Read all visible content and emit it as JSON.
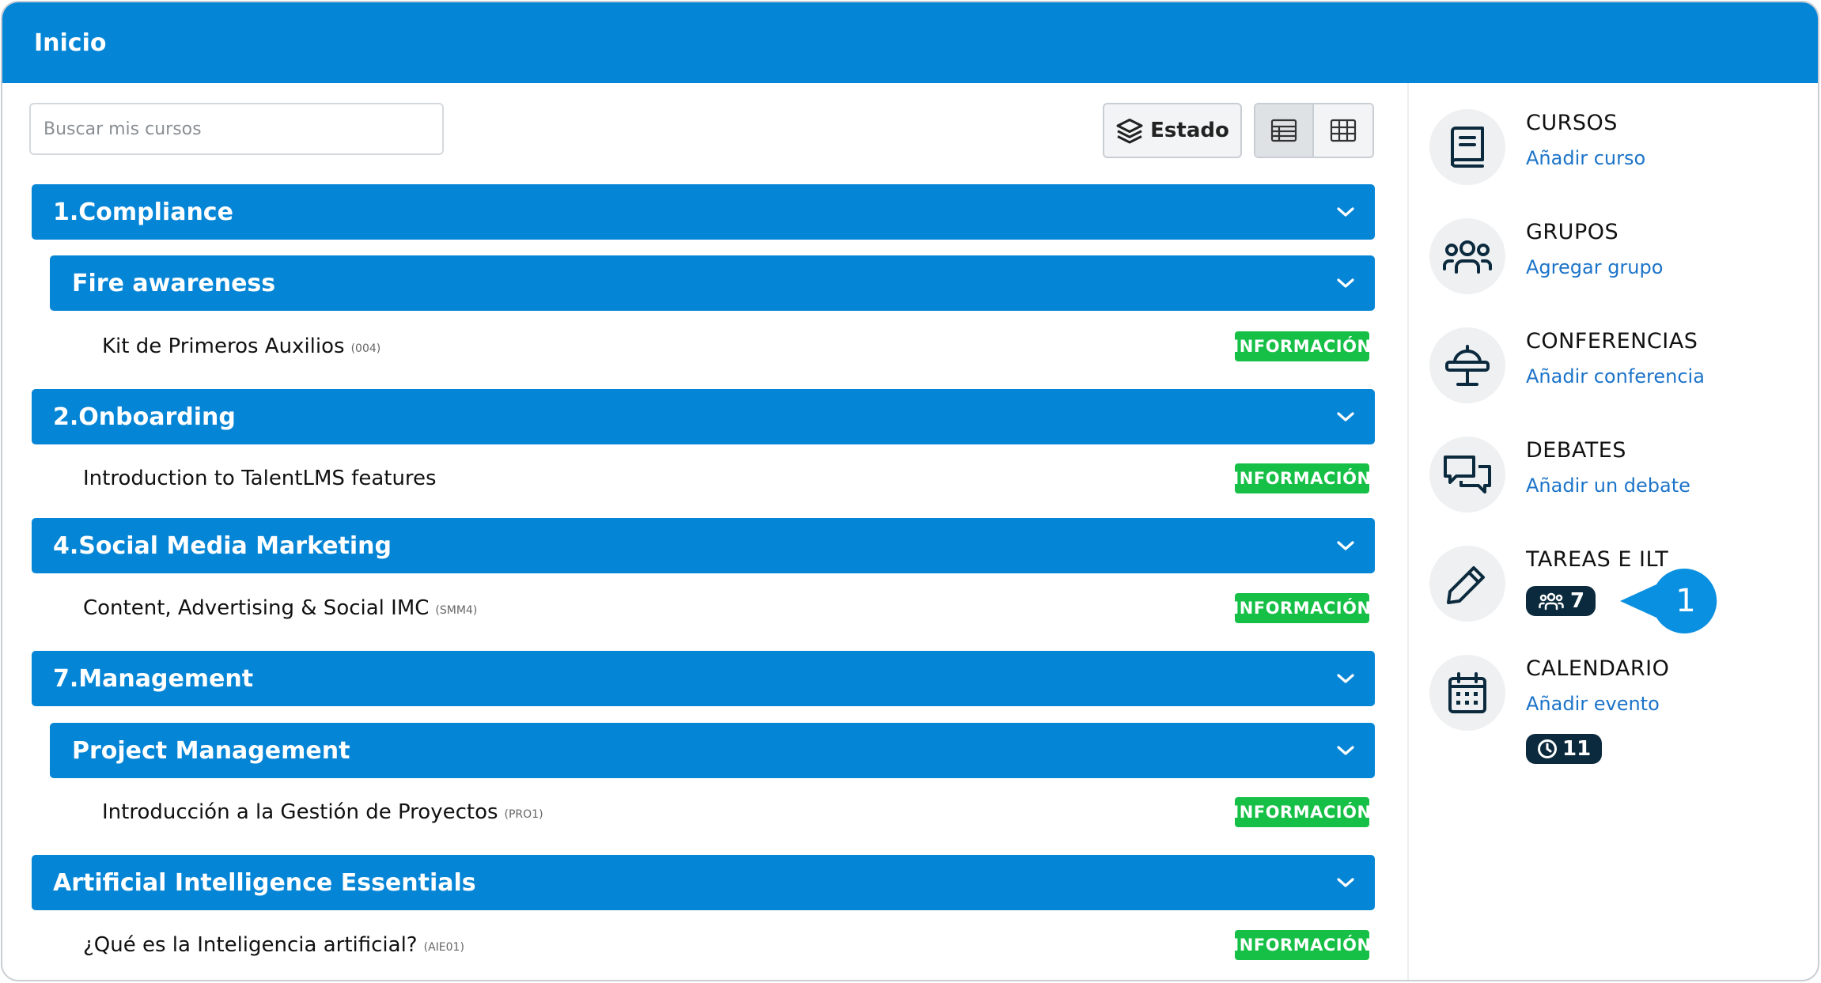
{
  "header": {
    "title": "Inicio"
  },
  "search": {
    "placeholder": "Buscar mis cursos"
  },
  "toolbar": {
    "estado_label": "Estado"
  },
  "categories": [
    {
      "label": "1.Compliance"
    },
    {
      "label": "Fire awareness"
    },
    {
      "label": "2.Onboarding"
    },
    {
      "label": "4.Social Media Marketing"
    },
    {
      "label": "7.Management"
    },
    {
      "label": "Project Management"
    },
    {
      "label": "Artificial Intelligence Essentials"
    }
  ],
  "courses": [
    {
      "name": "Kit de Primeros Auxilios",
      "code": "(004)",
      "badge": "INFORMACIÓN"
    },
    {
      "name": "Introduction to TalentLMS features",
      "code": "",
      "badge": "INFORMACIÓN"
    },
    {
      "name": "Content, Advertising & Social IMC",
      "code": "(SMM4)",
      "badge": "INFORMACIÓN"
    },
    {
      "name": "Introducción a la Gestión de Proyectos",
      "code": "(PRO1)",
      "badge": "INFORMACIÓN"
    },
    {
      "name": "¿Qué es la Inteligencia artificial?",
      "code": "(AIE01)",
      "badge": "INFORMACIÓN"
    }
  ],
  "sidebar": {
    "cursos": {
      "title": "CURSOS",
      "link": "Añadir curso"
    },
    "grupos": {
      "title": "GRUPOS",
      "link": "Agregar grupo"
    },
    "conferencias": {
      "title": "CONFERENCIAS",
      "link": "Añadir conferencia"
    },
    "debates": {
      "title": "DEBATES",
      "link": "Añadir un debate"
    },
    "tareas": {
      "title": "TAREAS E ILT",
      "count": "7"
    },
    "calendario": {
      "title": "CALENDARIO",
      "link": "Añadir evento",
      "count": "11"
    }
  },
  "callout": {
    "number": "1"
  },
  "colors": {
    "brand_blue": "#0585d6",
    "info_green": "#16bf46",
    "link_blue": "#1c74c9",
    "badge_dark": "#0c2a3d",
    "callout_blue": "#0a90e0"
  },
  "icons": {
    "estado": "layers-icon",
    "view_list": "table-list-icon",
    "view_grid": "grid-icon",
    "category_toggle": "chevron-down-icon",
    "cursos": "book-icon",
    "grupos": "users-icon",
    "conferencias": "presentation-icon",
    "debates": "chat-bubbles-icon",
    "tareas": "pencil-icon",
    "tareas_badge": "users-icon",
    "calendario": "calendar-icon",
    "calendario_badge": "clock-icon"
  }
}
